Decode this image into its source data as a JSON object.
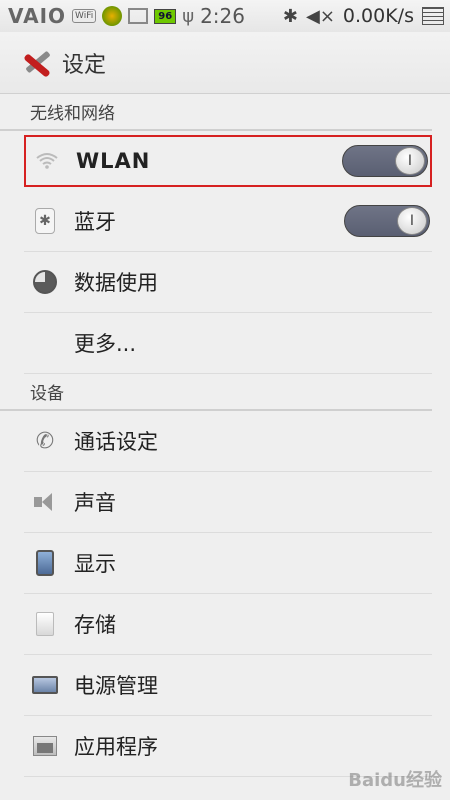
{
  "status_bar": {
    "brand": "VAIO",
    "wifi_badge": "WiFi",
    "battery_level": "96",
    "time": "2:26",
    "network_speed": "0.00K/s",
    "icons": [
      "wifi-badge-icon",
      "sync-icon",
      "image-icon",
      "battery-icon",
      "usb-icon",
      "android-icon",
      "bluetooth-icon",
      "mute-icon",
      "signal-grid-icon"
    ]
  },
  "action_bar": {
    "title": "设定",
    "icon": "settings-tools-icon"
  },
  "sections": [
    {
      "header": "无线和网络",
      "items": [
        {
          "label": "WLAN",
          "icon": "wifi-icon",
          "toggle": true,
          "toggle_symbol": "I",
          "highlighted": true
        },
        {
          "label": "蓝牙",
          "icon": "bluetooth-icon",
          "toggle": true,
          "toggle_symbol": "I"
        },
        {
          "label": "数据使用",
          "icon": "data-usage-icon"
        },
        {
          "label": "更多..."
        }
      ]
    },
    {
      "header": "设备",
      "items": [
        {
          "label": "通话设定",
          "icon": "phone-icon"
        },
        {
          "label": "声音",
          "icon": "speaker-icon"
        },
        {
          "label": "显示",
          "icon": "display-icon"
        },
        {
          "label": "存储",
          "icon": "storage-icon"
        },
        {
          "label": "电源管理",
          "icon": "battery-power-icon"
        },
        {
          "label": "应用程序",
          "icon": "apps-icon"
        }
      ]
    }
  ],
  "watermark": "Baidu经验",
  "colors": {
    "highlight_border": "#d62020",
    "toggle_on": "#5a5f72",
    "background": "#efefef"
  }
}
